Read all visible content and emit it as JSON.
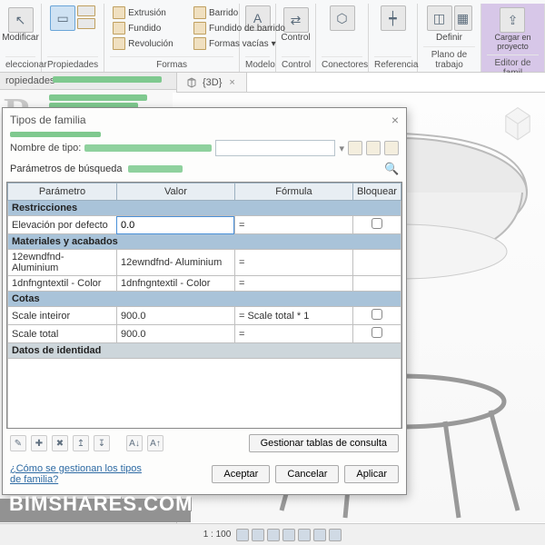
{
  "ribbon": {
    "modify": "Modificar",
    "select": "eleccionar",
    "properties": "Propiedades",
    "extrusion": "Extrusión",
    "blend": "Fundido",
    "revolution": "Revolución",
    "sweep": "Barrido",
    "sweptblend": "Fundido de barrido",
    "voidforms": "Formas vacías",
    "forms": "Formas",
    "model": "Modelo",
    "control": "Control",
    "controlgrp": "Control",
    "connectors": "Conectores",
    "reference": "Referencia",
    "define": "Definir",
    "workplane": "Plano de trabajo",
    "load": "Cargar en\nproyecto",
    "load2": "Cargar en\nproyecto",
    "editor": "Editor de famil"
  },
  "tabs": {
    "prop": "ropiedades",
    "view3d": "{3D}"
  },
  "dialog": {
    "title": "Tipos de familia",
    "nameLabel": "Nombre de tipo:",
    "searchLabel": "Parámetros de búsqueda",
    "headers": {
      "param": "Parámetro",
      "value": "Valor",
      "formula": "Fórmula",
      "lock": "Bloquear"
    },
    "sections": {
      "restricciones": "Restricciones",
      "materiales": "Materiales y acabados",
      "cotas": "Cotas",
      "identidad": "Datos de identidad"
    },
    "rows": {
      "elevacion": {
        "name": "Elevación por defecto",
        "value": "0.0",
        "formula": "="
      },
      "mat1": {
        "name": "12ewndfnd- Aluminium",
        "value": "12ewndfnd- Aluminium",
        "formula": "="
      },
      "mat2": {
        "name": "1dnfngntextil - Color",
        "value": "1dnfngntextil - Color",
        "formula": "="
      },
      "scale1": {
        "name": "Scale inteiror",
        "value": "900.0",
        "formula": "= Scale total * 1"
      },
      "scale2": {
        "name": "Scale total",
        "value": "900.0",
        "formula": "="
      }
    },
    "lookup": "Gestionar tablas de consulta",
    "help": "¿Cómo se gestionan los tipos de familia?",
    "ok": "Aceptar",
    "cancel": "Cancelar",
    "apply": "Aplicar"
  },
  "status": {
    "scale": "1 : 100"
  },
  "watermark": "BIMSHARES.COM"
}
